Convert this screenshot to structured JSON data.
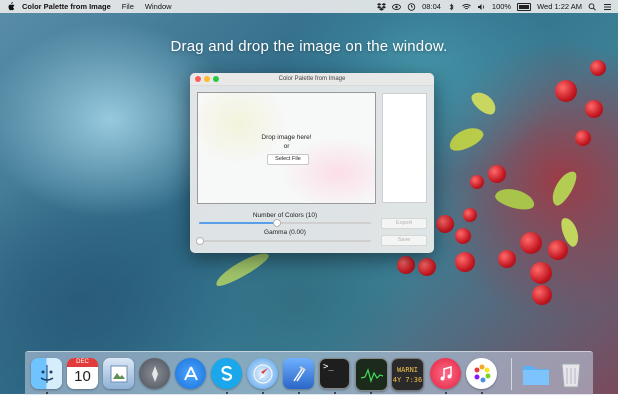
{
  "menubar": {
    "app_name": "Color Palette from Image",
    "menus": [
      "File",
      "Window"
    ],
    "clock": "08:04",
    "battery": "100%",
    "datetime": "Wed 1:22 AM"
  },
  "headline": "Drag and drop the image on the window.",
  "window": {
    "title": "Color Palette from Image",
    "drop_text": "Drop image here!",
    "or_text": "or",
    "select_button": "Select File",
    "colors_label": "Number of Colors (10)",
    "colors_level": 0.45,
    "gamma_label": "Gamma (0.00)",
    "gamma_level": 0.0,
    "export_button": "Export",
    "save_button": "Save"
  },
  "calendar": {
    "month": "DEC",
    "day": "10"
  },
  "terminal_prompt": ">_",
  "display_text": "WARNI",
  "display_time": "4Y 7:36",
  "dock": {
    "items": [
      {
        "name": "finder-icon",
        "running": true
      },
      {
        "name": "calendar-icon",
        "running": false
      },
      {
        "name": "preview-icon",
        "running": false
      },
      {
        "name": "launchpad-icon",
        "running": false
      },
      {
        "name": "app-store-icon",
        "running": false
      },
      {
        "name": "skype-icon",
        "running": true
      },
      {
        "name": "safari-icon",
        "running": true
      },
      {
        "name": "xcode-icon",
        "running": true
      },
      {
        "name": "terminal-icon",
        "running": true
      },
      {
        "name": "activity-monitor-icon",
        "running": true
      },
      {
        "name": "console-icon",
        "running": false
      },
      {
        "name": "itunes-icon",
        "running": true
      },
      {
        "name": "color-palette-app-icon",
        "running": true
      },
      {
        "name": "folder-icon",
        "running": false
      },
      {
        "name": "trash-icon",
        "running": false
      }
    ]
  },
  "colors": {
    "accent": "#5a9de8",
    "close": "#fc5f57",
    "minimize": "#fdbb2d",
    "zoom": "#29c840"
  }
}
